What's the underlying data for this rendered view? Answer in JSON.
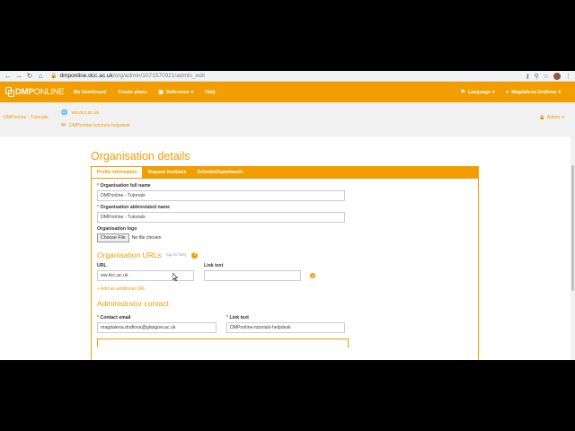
{
  "browser": {
    "url_host": "dmponline.dcc.ac.uk",
    "url_path": "/org/admin/1071570921/admin_edit"
  },
  "nav": {
    "logo_bold": "DMP",
    "logo_thin": "ONLINE",
    "items": [
      "My Dashboard",
      "Create plans",
      "Reference",
      "Help"
    ],
    "language": "Language",
    "user": "Magdalena Drafiova"
  },
  "org": {
    "name": "DMPonline - Tutorials",
    "url": "ww.dcc.ac.uk",
    "helpdesk": "DMPonline-tutorials-helpdesk",
    "admin": "Admin"
  },
  "page": {
    "title": "Organisation details",
    "tabs": [
      "Profile information",
      "Request feedback",
      "Schools/Departments"
    ]
  },
  "form": {
    "full_name_label": "Organisation full name",
    "full_name_value": "DMPonline - Tutorials",
    "abbrev_label": "Organisation abbreviated name",
    "abbrev_value": "DMPonline - Tutorials",
    "logo_label": "Organisation logo",
    "choose_file": "Choose File",
    "no_file": "No file chosen",
    "urls_title": "Organisation URLs",
    "urls_sub": "(up to five)",
    "url_label": "URL",
    "url_value": "ww.dcc.ac.uk",
    "link_text_label": "Link text",
    "link_text_value": "",
    "add_url": "+ Add an additional URL",
    "admin_title": "Administrator contact",
    "contact_email_label": "Contact email",
    "contact_email_value": "magdalena.drafiova@glasgow.ac.uk",
    "contact_link_label": "Link text",
    "contact_link_value": "DMPonline-tutorials-helpdesk"
  },
  "colors": {
    "accent": "#f29d00",
    "chrome": "#f1f3f4"
  },
  "icons": [
    "back-arrow-icon",
    "forward-arrow-icon",
    "reload-icon",
    "home-icon",
    "lock-icon",
    "key-icon",
    "zoom-icon",
    "star-icon",
    "globe-icon",
    "mail-icon",
    "user-icon",
    "help-icon",
    "remove-icon"
  ]
}
